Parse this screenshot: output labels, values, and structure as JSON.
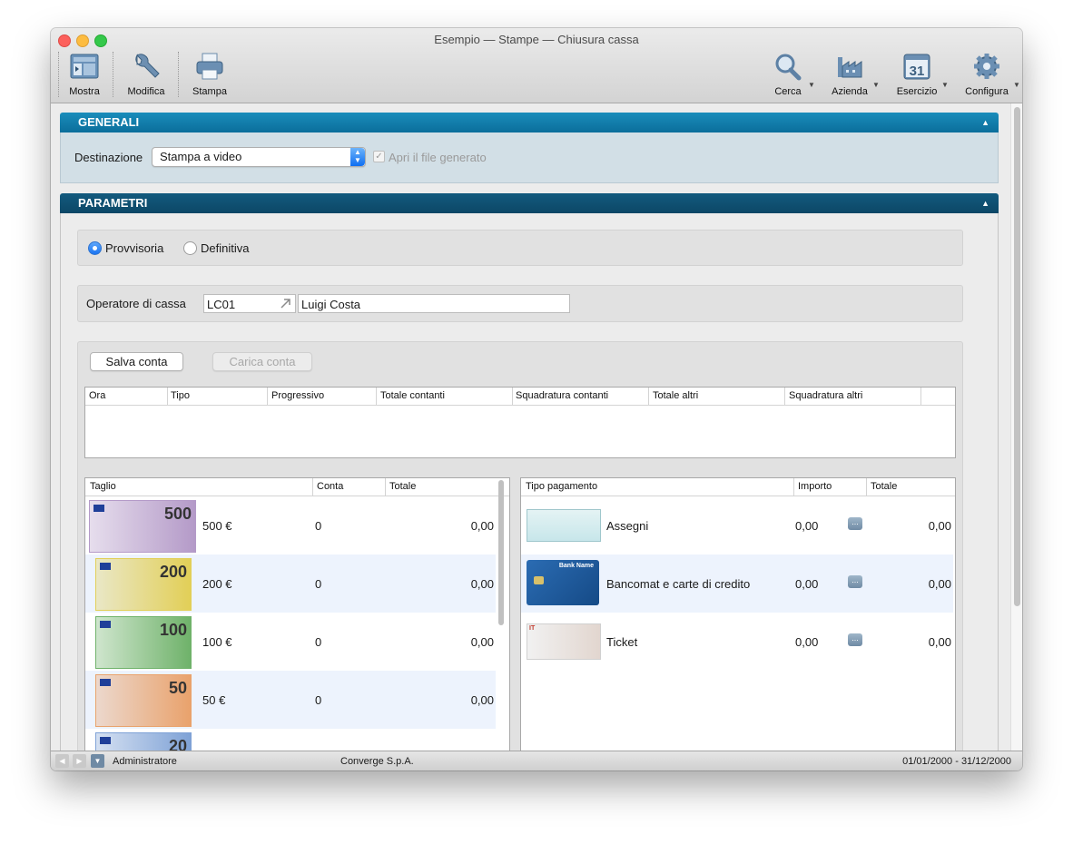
{
  "window": {
    "title": "Esempio — Stampe — Chiusura cassa"
  },
  "toolbar": {
    "left": [
      {
        "label": "Mostra",
        "icon": "sidebar-icon"
      },
      {
        "label": "Modifica",
        "icon": "wrench-icon"
      },
      {
        "label": "Stampa",
        "icon": "printer-icon"
      }
    ],
    "right": [
      {
        "label": "Cerca",
        "icon": "magnifier-icon"
      },
      {
        "label": "Azienda",
        "icon": "factory-icon"
      },
      {
        "label": "Esercizio",
        "icon": "calendar-icon",
        "day": "31"
      },
      {
        "label": "Configura",
        "icon": "gear-icon"
      }
    ]
  },
  "generali": {
    "title": "GENERALI",
    "destination_label": "Destinazione",
    "destination_value": "Stampa a video",
    "open_file_label": "Apri il file generato",
    "open_file_checked": true
  },
  "parametri": {
    "title": "PARAMETRI",
    "mode_options": [
      {
        "label": "Provvisoria",
        "selected": true
      },
      {
        "label": "Definitiva",
        "selected": false
      }
    ],
    "operator_label": "Operatore di cassa",
    "operator_code": "LC01",
    "operator_name": "Luigi Costa",
    "save_button": "Salva conta",
    "load_button": "Carica conta",
    "counts_table": {
      "columns": [
        "Ora",
        "Tipo",
        "Progressivo",
        "Totale contanti",
        "Squadratura contanti",
        "Totale altri",
        "Squadratura altri"
      ]
    },
    "denominations_table": {
      "columns": [
        "Taglio",
        "Conta",
        "Totale"
      ],
      "rows": [
        {
          "taglio": "500 €",
          "conta": "0",
          "totale": "0,00",
          "note_value": "500",
          "color": "#b49ac8"
        },
        {
          "taglio": "200 €",
          "conta": "0",
          "totale": "0,00",
          "note_value": "200",
          "color": "#e2cf57"
        },
        {
          "taglio": "100 €",
          "conta": "0",
          "totale": "0,00",
          "note_value": "100",
          "color": "#6fb26a"
        },
        {
          "taglio": "50 €",
          "conta": "0",
          "totale": "0,00",
          "note_value": "50",
          "color": "#e9a26c"
        },
        {
          "taglio": "",
          "conta": "",
          "totale": "",
          "note_value": "20",
          "color": "#7fa2d6"
        }
      ]
    },
    "payments_table": {
      "columns": [
        "Tipo pagamento",
        "Importo",
        "Totale"
      ],
      "rows": [
        {
          "tipo": "Assegni",
          "importo": "0,00",
          "totale": "0,00",
          "icon": "check-icon"
        },
        {
          "tipo": "Bancomat e carte di credito",
          "importo": "0,00",
          "totale": "0,00",
          "icon": "credit-card-icon",
          "card_text": "Bank Name"
        },
        {
          "tipo": "Ticket",
          "importo": "0,00",
          "totale": "0,00",
          "icon": "ticket-icon",
          "ticket_text": "IT"
        }
      ]
    }
  },
  "statusbar": {
    "user": "Administratore",
    "company": "Converge S.p.A.",
    "period": "01/01/2000 - 31/12/2000"
  }
}
